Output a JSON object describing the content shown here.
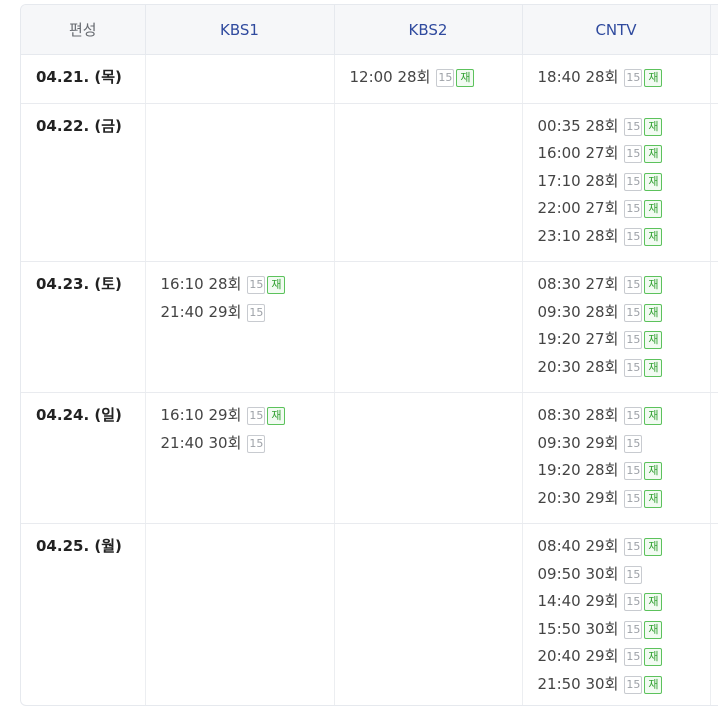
{
  "header": {
    "schedule": "편성",
    "channels": [
      "KBS1",
      "KBS2",
      "CNTV"
    ]
  },
  "rows": [
    {
      "date": "04.21. (목)",
      "KBS1": [],
      "KBS2": [
        {
          "time": "12:00",
          "ep": "28회",
          "age": "15",
          "re": "재"
        }
      ],
      "CNTV": [
        {
          "time": "18:40",
          "ep": "28회",
          "age": "15",
          "re": "재"
        }
      ]
    },
    {
      "date": "04.22. (금)",
      "KBS1": [],
      "KBS2": [],
      "CNTV": [
        {
          "time": "00:35",
          "ep": "28회",
          "age": "15",
          "re": "재"
        },
        {
          "time": "16:00",
          "ep": "27회",
          "age": "15",
          "re": "재"
        },
        {
          "time": "17:10",
          "ep": "28회",
          "age": "15",
          "re": "재"
        },
        {
          "time": "22:00",
          "ep": "27회",
          "age": "15",
          "re": "재"
        },
        {
          "time": "23:10",
          "ep": "28회",
          "age": "15",
          "re": "재"
        }
      ]
    },
    {
      "date": "04.23. (토)",
      "KBS1": [
        {
          "time": "16:10",
          "ep": "28회",
          "age": "15",
          "re": "재"
        },
        {
          "time": "21:40",
          "ep": "29회",
          "age": "15",
          "re": null
        }
      ],
      "KBS2": [],
      "CNTV": [
        {
          "time": "08:30",
          "ep": "27회",
          "age": "15",
          "re": "재"
        },
        {
          "time": "09:30",
          "ep": "28회",
          "age": "15",
          "re": "재"
        },
        {
          "time": "19:20",
          "ep": "27회",
          "age": "15",
          "re": "재"
        },
        {
          "time": "20:30",
          "ep": "28회",
          "age": "15",
          "re": "재"
        }
      ]
    },
    {
      "date": "04.24. (일)",
      "KBS1": [
        {
          "time": "16:10",
          "ep": "29회",
          "age": "15",
          "re": "재"
        },
        {
          "time": "21:40",
          "ep": "30회",
          "age": "15",
          "re": null
        }
      ],
      "KBS2": [],
      "CNTV": [
        {
          "time": "08:30",
          "ep": "28회",
          "age": "15",
          "re": "재"
        },
        {
          "time": "09:30",
          "ep": "29회",
          "age": "15",
          "re": null
        },
        {
          "time": "19:20",
          "ep": "28회",
          "age": "15",
          "re": "재"
        },
        {
          "time": "20:30",
          "ep": "29회",
          "age": "15",
          "re": "재"
        }
      ]
    },
    {
      "date": "04.25. (월)",
      "KBS1": [],
      "KBS2": [],
      "CNTV": [
        {
          "time": "08:40",
          "ep": "29회",
          "age": "15",
          "re": "재"
        },
        {
          "time": "09:50",
          "ep": "30회",
          "age": "15",
          "re": null
        },
        {
          "time": "14:40",
          "ep": "29회",
          "age": "15",
          "re": "재"
        },
        {
          "time": "15:50",
          "ep": "30회",
          "age": "15",
          "re": "재"
        },
        {
          "time": "20:40",
          "ep": "29회",
          "age": "15",
          "re": "재"
        },
        {
          "time": "21:50",
          "ep": "30회",
          "age": "15",
          "re": "재"
        }
      ]
    }
  ]
}
